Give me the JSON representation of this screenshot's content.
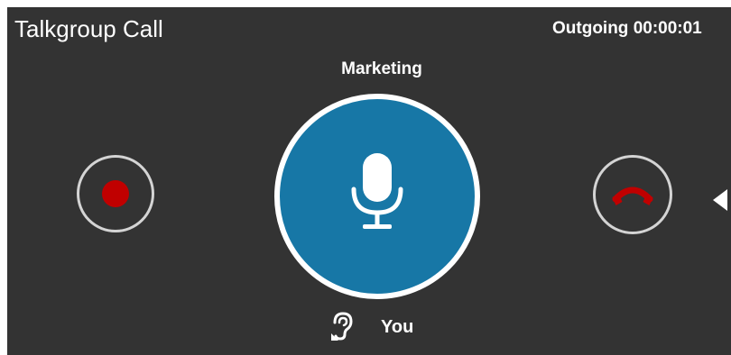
{
  "call": {
    "title": "Talkgroup Call",
    "status": "Outgoing 00:00:01",
    "talkgroup": "Marketing",
    "current_speaker": "You"
  },
  "icons": {
    "record": "record-icon",
    "ptt": "microphone-icon",
    "hangup": "hang-up-phone-icon",
    "speaker": "ear-icon",
    "side_panel": "triangle-left-icon"
  },
  "colors": {
    "background": "#333333",
    "ptt_button": "#1777a6",
    "record_dot": "#c00000",
    "hangup": "#c00000",
    "ring": "#d4d4d4",
    "text": "#ffffff"
  }
}
